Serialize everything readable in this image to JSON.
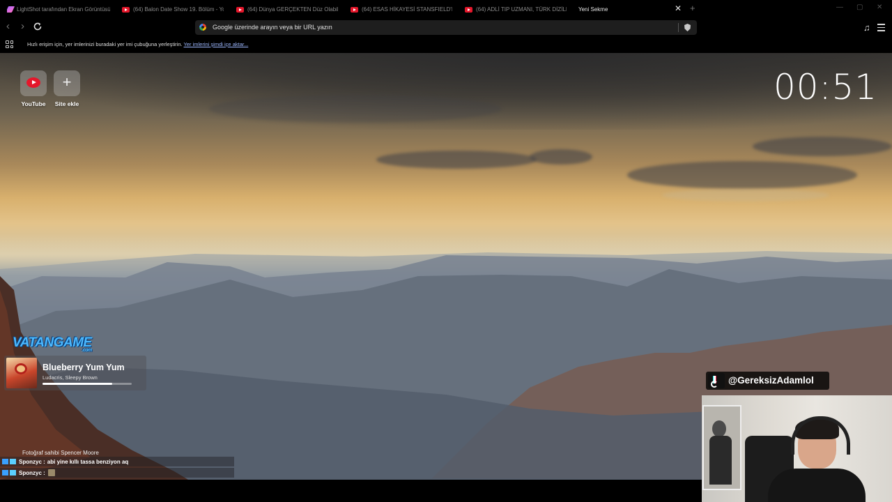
{
  "tabs": [
    {
      "label": "LightShot tarafından Ekran Görüntüsü",
      "icon": "lightshot-icon"
    },
    {
      "label": "(64) Balon Date Show 19. Bölüm - YouTube",
      "icon": "youtube-icon"
    },
    {
      "label": "(64) Dünya GERÇEKTEN Düz Olabilir",
      "icon": "youtube-icon"
    },
    {
      "label": "(64) ESAS HİKAYESİ STANSFIELD'DIR",
      "icon": "youtube-icon"
    },
    {
      "label": "(64) ADLİ TIP UZMANI, TÜRK DİZİLER",
      "icon": "youtube-icon"
    },
    {
      "label": "Yeni Sekme",
      "icon": ""
    }
  ],
  "toolbar": {
    "omnibox_placeholder": "Google üzerinde arayın veya bir URL yazın"
  },
  "bookmarks_bar": {
    "prompt": "Hızlı erişim için, yer imlerinizi buradaki yer imi çubuğuna yerleştirin.",
    "import_link": "Yer imlerini şimdi içe aktar..."
  },
  "shortcuts": [
    {
      "label": "YouTube",
      "icon": "youtube-icon"
    },
    {
      "label": "Site ekle",
      "icon": "plus-icon"
    }
  ],
  "clock": "00:51",
  "overlay": {
    "brand": "VATANGAME",
    "brand_sub": ".com",
    "now_playing": {
      "title": "Blueberry Yum Yum",
      "artist": "Ludacris, Sleepy Brown",
      "progress": 0.78
    },
    "photo_credit": "Fotoğraf sahibi Spencer Moore",
    "chat": [
      {
        "user": "Sponzyc :",
        "message": "abi yine kıllı tassa benziyon aq"
      },
      {
        "user": "Sponzyc :",
        "message": ""
      }
    ],
    "tiktok_handle": "@GereksizAdamlol"
  },
  "colors": {
    "accent_link": "#9db8ff",
    "youtube_red": "#e5172b",
    "brand_blue": "#4cb9ff"
  }
}
